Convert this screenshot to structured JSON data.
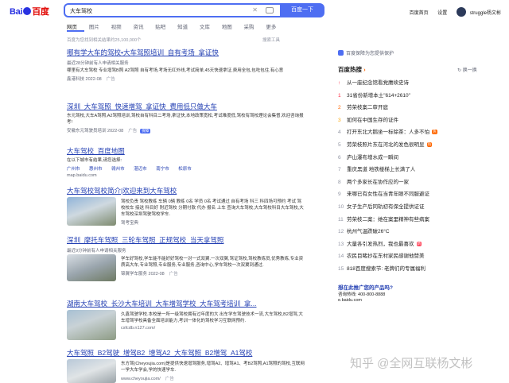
{
  "header": {
    "logo_text_left": "Bai",
    "logo_text_right": "百度",
    "search_query": "大车驾校",
    "search_button": "百度一下",
    "links": [
      "百度首页",
      "设置"
    ],
    "username": "struggle杨文彬"
  },
  "tabs": [
    "网页",
    "图片",
    "视频",
    "资讯",
    "贴吧",
    "知道",
    "文库",
    "地图",
    "采购",
    "更多"
  ],
  "result_count": "百度为您找到相关结果约25,100,000个",
  "search_tools": "搜索工具",
  "results": [
    {
      "title": "哪有学大车的驾校•大车驾照培训_自有考场_拿证快",
      "subline": "最近28分钟前有人申请相关服务",
      "abstract": "哪里有大车驾校 专业增驾B照 A2驾照 自有考场,考场无红外线,考试简单,45天快速拿证,费用全包,包吃包住,有心意",
      "source": "鑫港科技 2022-08",
      "ad": "广告"
    },
    {
      "title": "深圳_大车驾照_快速增驾_拿证快_费用低只做大车",
      "abstract": "东元驾校,大车A驾照,A2驾照培训,驾校自有科目二考场,拿证快,本地政策宽松,考试难度低,驾校有驾校理论会集督,欢迎咨询报考!",
      "source": "安徽东元驾驶员培训 2022-08",
      "ad": "广告",
      "badge": "保障"
    },
    {
      "title": "大车驾校_百度地图",
      "abstract": "在以下城市有结果,请您选择:",
      "cities": [
        "广州市",
        "惠州市",
        "赣州市",
        "湛迈市",
        "南宁市",
        "松原市"
      ],
      "source": "map.baidu.com"
    },
    {
      "title": "大车驾校驾校简介|欢迎来到大车驾校",
      "abstract": "驾校负责 驾校教练 车辆 0辆 教练 0名 学员 0名 考试通过 自有考场 科三 科四场可预约 考试 驾校校车 接送 科目好 附近驾校 分期付款 代办 报名 上车 查询大车驾校,大车驾校科目大车驾校,大车驾校深圳驾驶驾校学车.",
      "source": "驾考宝典"
    },
    {
      "title": "深圳_摩托车驾照_三轮车驾照_正规驾校_当天拿驾照",
      "subline": "最近9分钟前有人申请相关服务",
      "abstract": "学车好驾校,学车能不能好好驾校一对一式双翼.一次双翼,驾证驾校,驾校教练员,优秀教练,专业资质高大车,专业驾照,专业服务,专业服务,咨询中心,学车驾校一次双翼到通过.",
      "source": "锦翼学车服务 2022-08",
      "ad": "广告"
    },
    {
      "title": "湖南大车驾校_长沙大车培训_大车增驾学校_大车驾考培训_拿...",
      "abstract": "久鑫驾驶学校.本校是一所一级驾校拥有过年度的大 出车学车驾驶技术一流,大车驾校,B2增驾,大车增驾学校具备全面培训能力,考训一体化的驾校学习互联网预约.",
      "source": "csfcdb.n127.com/"
    },
    {
      "title": "大车驾照_B2驾驶_增驾B2_增驾A2_大车驾照_B2增驾_A1驾校",
      "abstract": "东方驾(Cheyoujia.com)是提供快速增驾服务,增驾A2、增驾A1、考B2驾照,A1驾照的驾校,互联网一学大车学会,学的快速学车.",
      "source": "www.cheyoujia.com/",
      "ad": "广告"
    }
  ],
  "right": {
    "ad_notice": "百度保障为您提供保护",
    "hot_title": "百度热搜",
    "refresh": "换一换",
    "hot_list": [
      {
        "rank": "",
        "text": "从一座纪念馆看党赓续史诗",
        "tag": ""
      },
      {
        "rank": "1",
        "text": "31省份新增本土\"614+2610\"",
        "tag": ""
      },
      {
        "rank": "2",
        "text": "劳荣枝案二审开庭",
        "tag": ""
      },
      {
        "rank": "3",
        "text": "如何在中国生存的证件",
        "tag": ""
      },
      {
        "rank": "4",
        "text": "打开东北大鹅坐一标除茶：人多不怕",
        "tag": "热"
      },
      {
        "rank": "5",
        "text": "劳荣枝照片东在河北的发色很明显",
        "tag": "热"
      },
      {
        "rank": "6",
        "text": "庐山瀑布增水成一瞬间",
        "tag": ""
      },
      {
        "rank": "7",
        "text": "重庆黑道 地铁楼梯上长满了人",
        "tag": ""
      },
      {
        "rank": "8",
        "text": "两个多家长在协作应的一家",
        "tag": ""
      },
      {
        "rank": "9",
        "text": "来哪已有女性在当青年眼不同服避证",
        "tag": ""
      },
      {
        "rank": "10",
        "text": "女子生产后同轨初有保全提供证证",
        "tag": ""
      },
      {
        "rank": "11",
        "text": "劳荣枝二案：她在案里精神有些病案",
        "tag": ""
      },
      {
        "rank": "12",
        "text": "杭州气温跌破26°C",
        "tag": ""
      },
      {
        "rank": "13",
        "text": "大量各引发热烈，我也最喜欢",
        "tag": "新"
      },
      {
        "rank": "14",
        "text": "农民目睹抄在东村家民感谢他赞美",
        "tag": ""
      },
      {
        "rank": "15",
        "text": "818百度搜索节: 老牌们的专属福利",
        "tag": ""
      }
    ],
    "ad_question": "想在此推广您的产品吗?",
    "ad_contact_label": "咨询热线: 400-800-8888",
    "ad_contact_site": "e.baidu.com"
  },
  "watermark": "知乎 @全网互联杨文彬"
}
